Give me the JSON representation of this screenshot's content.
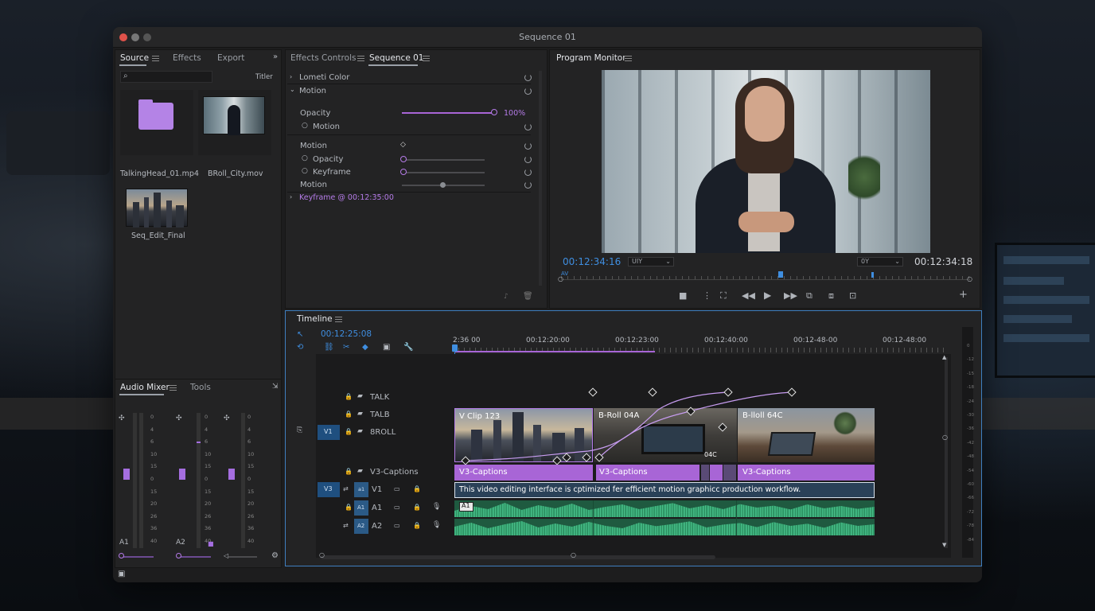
{
  "window": {
    "title": "Sequence 01"
  },
  "source_panel": {
    "tabs": [
      "Source",
      "Effects",
      "Export"
    ],
    "search": {
      "placeholder": "",
      "filter_label": "Titler"
    },
    "items": [
      {
        "name": "TalkingHead_01.mp4",
        "icon": "folder-icon"
      },
      {
        "name": "BRoll_City.mov",
        "icon": "video-thumb"
      },
      {
        "name": "Seq_Edit_Final",
        "icon": "city-thumb"
      }
    ]
  },
  "effects_panel": {
    "tabs": [
      "Effects Controls",
      "Sequence 01"
    ],
    "rows": [
      {
        "label": "Lometi Color"
      },
      {
        "label": "Motion"
      },
      {
        "label": "Opacity",
        "value": "100%"
      },
      {
        "label": "Motion"
      },
      {
        "label": "Motion"
      },
      {
        "label": "Opacity"
      },
      {
        "label": "Keyframe"
      },
      {
        "label": "Motion"
      },
      {
        "label": "Keyframe @ 00:12:35:00"
      }
    ],
    "levels": {
      "opacity_top": 0.93,
      "opacity_sub": 0.0,
      "keyframe_sub": 0.0,
      "motion_bottom": 0.5
    }
  },
  "program_monitor": {
    "title": "Program Monitor",
    "timecode_left": "00:12:34:16",
    "timecode_right": "00:12:34:18",
    "zoom_select": "UIY",
    "quality_select": "0Y",
    "playhead_label": "AV"
  },
  "audio_mixer": {
    "tabs": [
      "Audio Mixer",
      "Tools"
    ],
    "scale": [
      "0",
      "4",
      "6",
      "10",
      "15",
      "0",
      "15",
      "20",
      "26",
      "36",
      "40",
      "50"
    ],
    "channels": [
      "A1",
      "A2",
      ""
    ]
  },
  "timeline": {
    "title": "Timeline",
    "timecode": "00:12:25:08",
    "ruler": [
      "2:36 00",
      "00:12:20:00",
      "00:12:23:00",
      "00:12:40:00",
      "00:12-48-00",
      "00:12-48:00"
    ],
    "tracks": [
      {
        "name": "TALK"
      },
      {
        "name": "TALB"
      },
      {
        "name": "8ROLL",
        "patch": "V1"
      },
      {
        "name": "V3-Captions"
      },
      {
        "name": "V1",
        "patch": "V3",
        "source": "a1"
      },
      {
        "name": "A1",
        "source": "A1"
      },
      {
        "name": "A2",
        "source": "A2"
      }
    ],
    "clips": {
      "video": [
        "V Clip 123",
        "B-Roll 04A",
        "B-lloll 64C"
      ],
      "badge": "04C",
      "captions": [
        "V3-Captions",
        "V3-Captions",
        "V3-Captions"
      ],
      "text_clip": "This video editing interface is cptimized fer efficient motion graphicc production workflow.",
      "audio_label": "A1"
    },
    "meter_scale": [
      "0",
      "-12",
      "-15",
      "-18",
      "-24",
      "-30",
      "-36",
      "-42",
      "-48",
      "-54",
      "-60",
      "-66",
      "-72",
      "-78",
      "-84",
      "dB"
    ]
  },
  "colors": {
    "accent": "#b57be8",
    "playhead": "#3f8ee0",
    "audio": "#3fb37f",
    "caption": "#a865d6"
  }
}
